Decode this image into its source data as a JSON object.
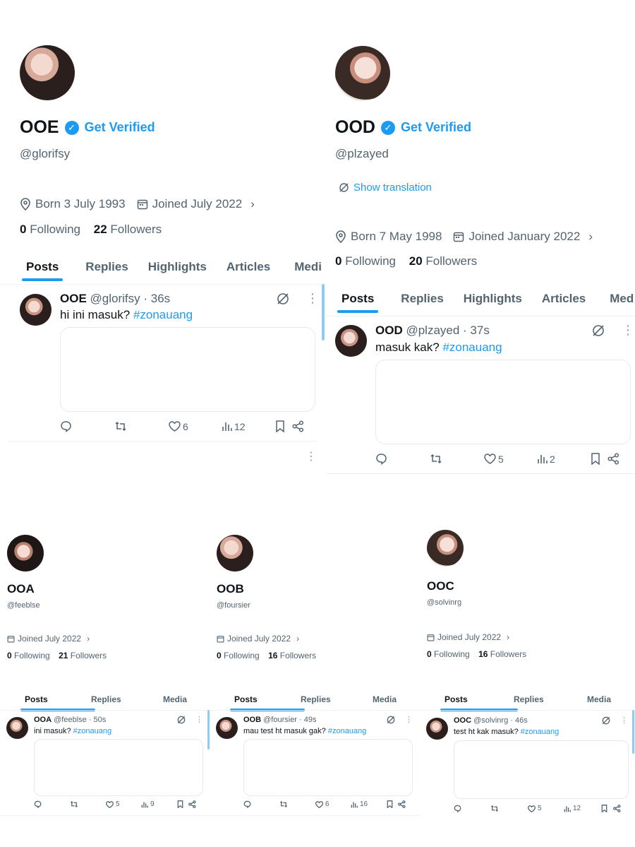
{
  "panels": [
    {
      "name": "OOE",
      "handle": "@glorifsy",
      "get_verified": "Get Verified",
      "born": "Born 3 July 1993",
      "joined": "Joined July 2022",
      "following_count": "0",
      "following_label": "Following",
      "followers_count": "22",
      "followers_label": "Followers",
      "tabs": [
        "Posts",
        "Replies",
        "Highlights",
        "Articles",
        "Medi"
      ],
      "post": {
        "author": "OOE",
        "handle_time": "@glorifsy · 36s",
        "text": "hi ini masuk? ",
        "hashtag": "#zonauang",
        "likes": "6",
        "views": "12"
      }
    },
    {
      "name": "OOD",
      "handle": "@plzayed",
      "get_verified": "Get Verified",
      "translation": "Show translation",
      "born": "Born 7 May 1998",
      "joined": "Joined January 2022",
      "following_count": "0",
      "following_label": "Following",
      "followers_count": "20",
      "followers_label": "Followers",
      "tabs": [
        "Posts",
        "Replies",
        "Highlights",
        "Articles",
        "Med"
      ],
      "post": {
        "author": "OOD",
        "handle_time": "@plzayed · 37s",
        "text": "masuk kak? ",
        "hashtag": "#zonauang",
        "likes": "5",
        "views": "2"
      }
    },
    {
      "name": "OOA",
      "handle": "@feeblse",
      "joined": "Joined July 2022",
      "following_count": "0",
      "following_label": "Following",
      "followers_count": "21",
      "followers_label": "Followers",
      "tabs": [
        "Posts",
        "Replies",
        "Media"
      ],
      "post": {
        "author": "OOA",
        "handle_time": "@feeblse · 50s",
        "text": "ini masuk? ",
        "hashtag": "#zonauang",
        "likes": "5",
        "views": "9"
      }
    },
    {
      "name": "OOB",
      "handle": "@foursier",
      "joined": "Joined July 2022",
      "following_count": "0",
      "following_label": "Following",
      "followers_count": "16",
      "followers_label": "Followers",
      "tabs": [
        "Posts",
        "Replies",
        "Media"
      ],
      "post": {
        "author": "OOB",
        "handle_time": "@foursier · 49s",
        "text": "mau test ht masuk gak? ",
        "hashtag": "#zonauang",
        "likes": "6",
        "views": "16"
      }
    },
    {
      "name": "OOC",
      "handle": "@solvinrg",
      "joined": "Joined July 2022",
      "following_count": "0",
      "following_label": "Following",
      "followers_count": "16",
      "followers_label": "Followers",
      "tabs": [
        "Posts",
        "Replies",
        "Media"
      ],
      "post": {
        "author": "OOC",
        "handle_time": "@solvinrg · 46s",
        "text": "test ht kak masuk? ",
        "hashtag": "#zonauang",
        "likes": "5",
        "views": "12"
      }
    }
  ],
  "colors": {
    "accent": "#1d9bf0",
    "text": "#0f1419",
    "muted": "#536471"
  },
  "icons": [
    "verified-badge-icon",
    "location-icon",
    "calendar-icon",
    "chevron-right-icon",
    "translate-icon",
    "grok-icon",
    "more-icon",
    "reply-icon",
    "retweet-icon",
    "like-icon",
    "views-icon",
    "bookmark-icon",
    "share-icon"
  ]
}
